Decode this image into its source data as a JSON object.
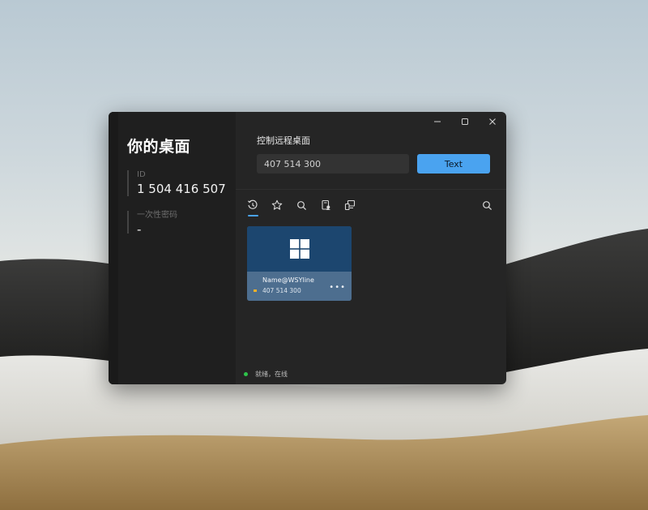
{
  "sidebar": {
    "title": "你的桌面",
    "id_label": "ID",
    "id_value": "1 504 416 507",
    "password_label": "一次性密码",
    "password_value": "-"
  },
  "window_controls": {
    "minimize_icon": "minimize-icon",
    "maximize_icon": "maximize-icon",
    "close_icon": "close-icon"
  },
  "control": {
    "title": "控制远程桌面",
    "input_value": "407 514 300",
    "connect_label": "Text"
  },
  "tabs": [
    {
      "name": "recent",
      "icon": "history-icon",
      "active": true
    },
    {
      "name": "favorites",
      "icon": "star-icon",
      "active": false
    },
    {
      "name": "discovered",
      "icon": "search-icon",
      "active": false
    },
    {
      "name": "address-book",
      "icon": "address-book-icon",
      "active": false
    },
    {
      "name": "device-group",
      "icon": "device-group-icon",
      "active": false
    }
  ],
  "peers": [
    {
      "name": "Name@WSYline",
      "id": "407 514 300",
      "os_icon": "windows-logo-icon",
      "more": "•••"
    }
  ],
  "status": {
    "text": "就绪，在线",
    "color": "#2ec34a"
  },
  "colors": {
    "accent": "#4aa3f0",
    "window_bg": "#252525",
    "sidebar_bg": "#1f1f1f",
    "card_top": "#1c466f",
    "card_bottom": "#4d6e8f"
  }
}
